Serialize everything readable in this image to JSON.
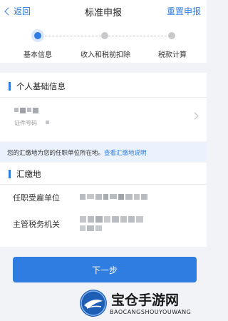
{
  "header": {
    "back_label": "返回",
    "title": "标准申报",
    "reset_label": "重置申报"
  },
  "steps": [
    {
      "label": "基本信息",
      "state": "active"
    },
    {
      "label": "收入和税前扣除",
      "state": "pending"
    },
    {
      "label": "税款计算",
      "state": "pending"
    }
  ],
  "personal_section": {
    "title": "个人基础信息",
    "id_label": "证件号码"
  },
  "notice": {
    "text": "您的汇缴地为您的任职单位所在地。",
    "link_label": "查看汇缴地说明"
  },
  "remit_section": {
    "title": "汇缴地",
    "fields": [
      {
        "label": "任职受雇单位"
      },
      {
        "label": "主管税务机关"
      }
    ]
  },
  "actions": {
    "next_label": "下一步"
  },
  "watermark": {
    "name": "宝仓手游网",
    "domain": "BAOCANGSHOUYOUWANG"
  },
  "colors": {
    "accent": "#2f7de1",
    "background": "#f2f3f7"
  }
}
